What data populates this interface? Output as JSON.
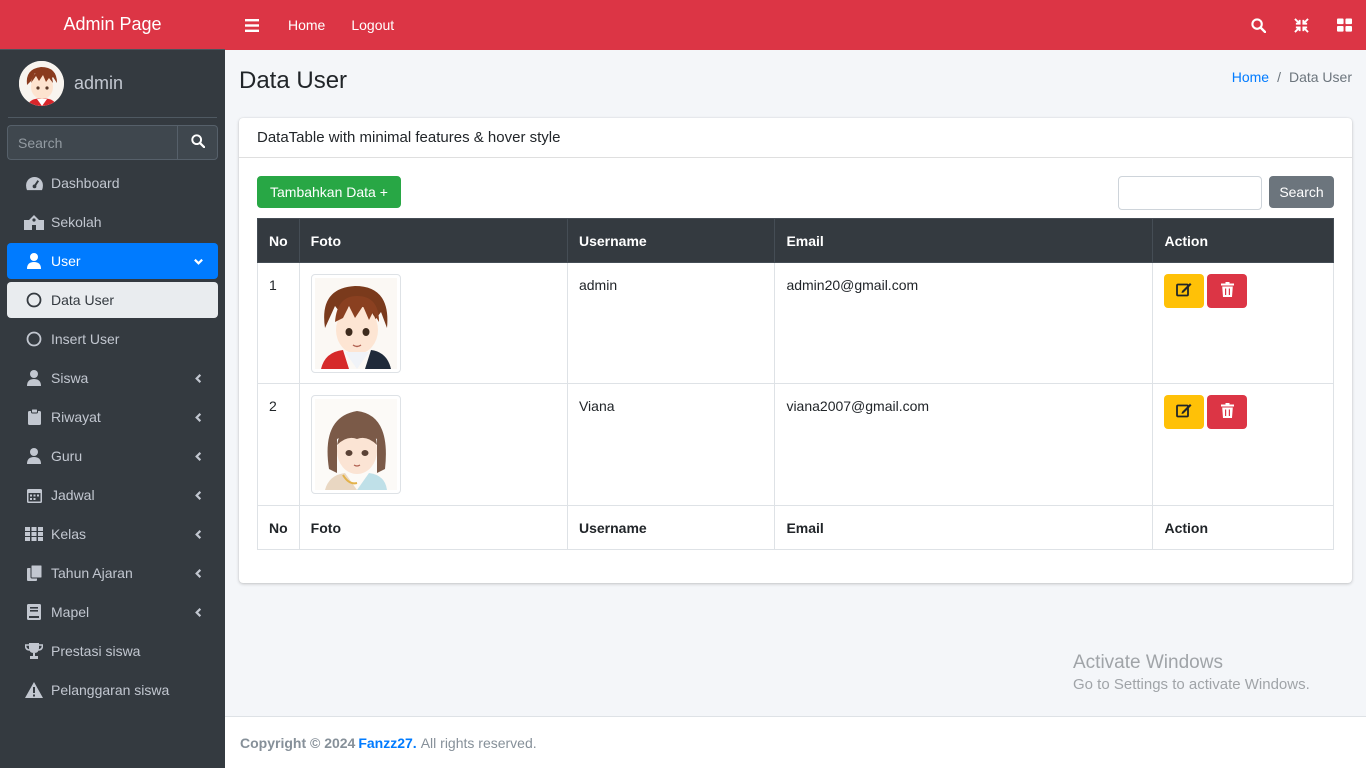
{
  "brand": "Admin Page",
  "user": {
    "name": "admin"
  },
  "sidebar": {
    "search_placeholder": "Search",
    "items": [
      {
        "label": "Dashboard",
        "icon": "tachometer-icon"
      },
      {
        "label": "Sekolah",
        "icon": "school-icon"
      },
      {
        "label": "User",
        "icon": "user-icon",
        "state": "active",
        "expanded": true
      },
      {
        "label": "Data User",
        "icon": "circle-icon",
        "state": "sub-active"
      },
      {
        "label": "Insert User",
        "icon": "circle-icon"
      },
      {
        "label": "Siswa",
        "icon": "user-icon"
      },
      {
        "label": "Riwayat",
        "icon": "clipboard-icon"
      },
      {
        "label": "Guru",
        "icon": "user-icon"
      },
      {
        "label": "Jadwal",
        "icon": "calendar-icon"
      },
      {
        "label": "Kelas",
        "icon": "grid-icon"
      },
      {
        "label": "Tahun Ajaran",
        "icon": "copy-icon"
      },
      {
        "label": "Mapel",
        "icon": "book-icon"
      },
      {
        "label": "Prestasi siswa",
        "icon": "trophy-icon"
      },
      {
        "label": "Pelanggaran siswa",
        "icon": "warning-icon"
      }
    ]
  },
  "topbar": {
    "home": "Home",
    "logout": "Logout"
  },
  "page": {
    "title": "Data User",
    "breadcrumb": {
      "home": "Home",
      "sep": "/",
      "current": "Data User"
    }
  },
  "card": {
    "header": "DataTable with minimal features & hover style",
    "add_button": "Tambahkan Data +",
    "search_button": "Search"
  },
  "table": {
    "columns": [
      "No",
      "Foto",
      "Username",
      "Email",
      "Action"
    ],
    "rows": [
      {
        "no": "1",
        "username": "admin",
        "email": "admin20@gmail.com"
      },
      {
        "no": "2",
        "username": "Viana",
        "email": "viana2007@gmail.com"
      }
    ]
  },
  "watermark": {
    "line1": "Activate Windows",
    "line2": "Go to Settings to activate Windows."
  },
  "footer": {
    "copyright": "Copyright © 2024",
    "brand": "Fanzz27.",
    "rest": "All rights reserved."
  },
  "colors": {
    "topbar": "#dc3545",
    "sidebar": "#343a40",
    "active": "#007bff",
    "add": "#28a745",
    "edit": "#ffc107",
    "delete": "#dc3545"
  }
}
